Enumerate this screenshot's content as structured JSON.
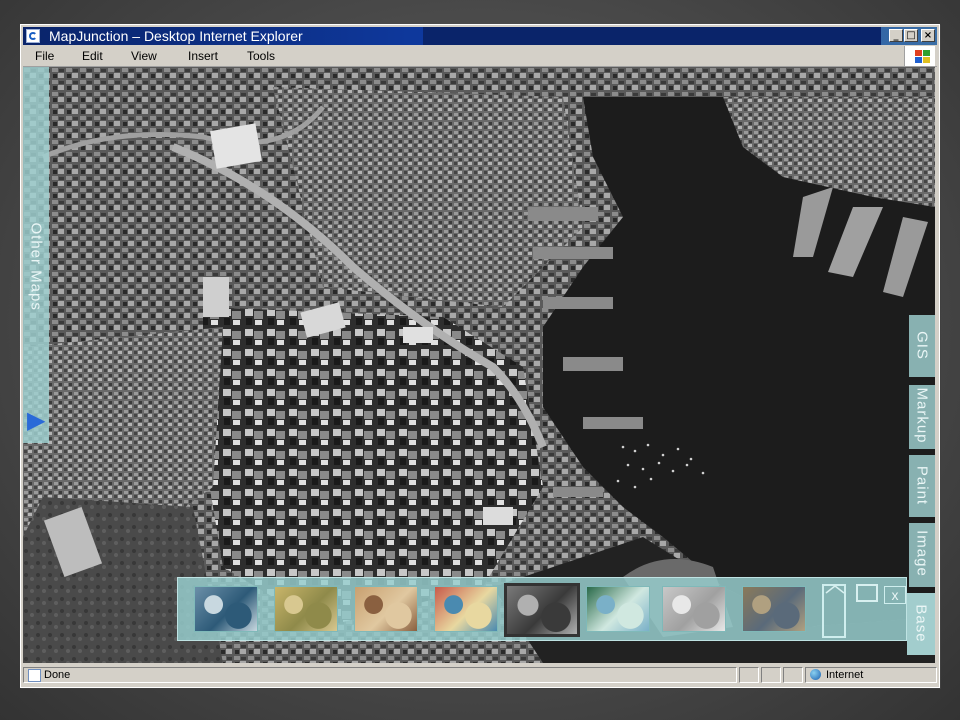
{
  "window": {
    "title": "MapJunction – Desktop  Internet Explorer",
    "minimize_glyph": "_",
    "maximize_glyph": "□",
    "close_glyph": "×"
  },
  "menu": {
    "items": [
      "File",
      "Edit",
      "View",
      "Insert",
      "Tools"
    ]
  },
  "side_panel": {
    "label": "Other Maps",
    "arrow_glyph": "▶"
  },
  "right_tabs": [
    "GIS",
    "Markup",
    "Paint",
    "Image",
    "Base"
  ],
  "thumbnails": {
    "close_label": "x",
    "items": [
      {
        "name": "satellite-color",
        "colors": [
          "#6b8fa8",
          "#2d5a78",
          "#c8d8e0"
        ],
        "selected": false
      },
      {
        "name": "historic-yellow",
        "colors": [
          "#c9b56a",
          "#8f8a4a",
          "#d8c890"
        ],
        "selected": false
      },
      {
        "name": "historic-sepia",
        "colors": [
          "#c8a070",
          "#e0c8a0",
          "#8a6040"
        ],
        "selected": false
      },
      {
        "name": "street-map-red",
        "colors": [
          "#c85a4a",
          "#e8d8a0",
          "#4a8ab0"
        ],
        "selected": false
      },
      {
        "name": "grayscale-aerial",
        "colors": [
          "#7a7a7a",
          "#3a3a3a",
          "#b0b0b0"
        ],
        "selected": true
      },
      {
        "name": "green-topo",
        "colors": [
          "#2a6a4a",
          "#d0e8e0",
          "#7ab0c8"
        ],
        "selected": false
      },
      {
        "name": "light-gray",
        "colors": [
          "#c8c8c8",
          "#a0a0a0",
          "#e8e8e8"
        ],
        "selected": false
      },
      {
        "name": "aerial-sepia",
        "colors": [
          "#8a7a5a",
          "#5a6a7a",
          "#b0a080"
        ],
        "selected": false
      }
    ]
  },
  "status": {
    "text": "Done",
    "zone": "Internet"
  },
  "colors": {
    "panel_teal": "#a0d2d2",
    "title_blue": "#0a246a"
  }
}
